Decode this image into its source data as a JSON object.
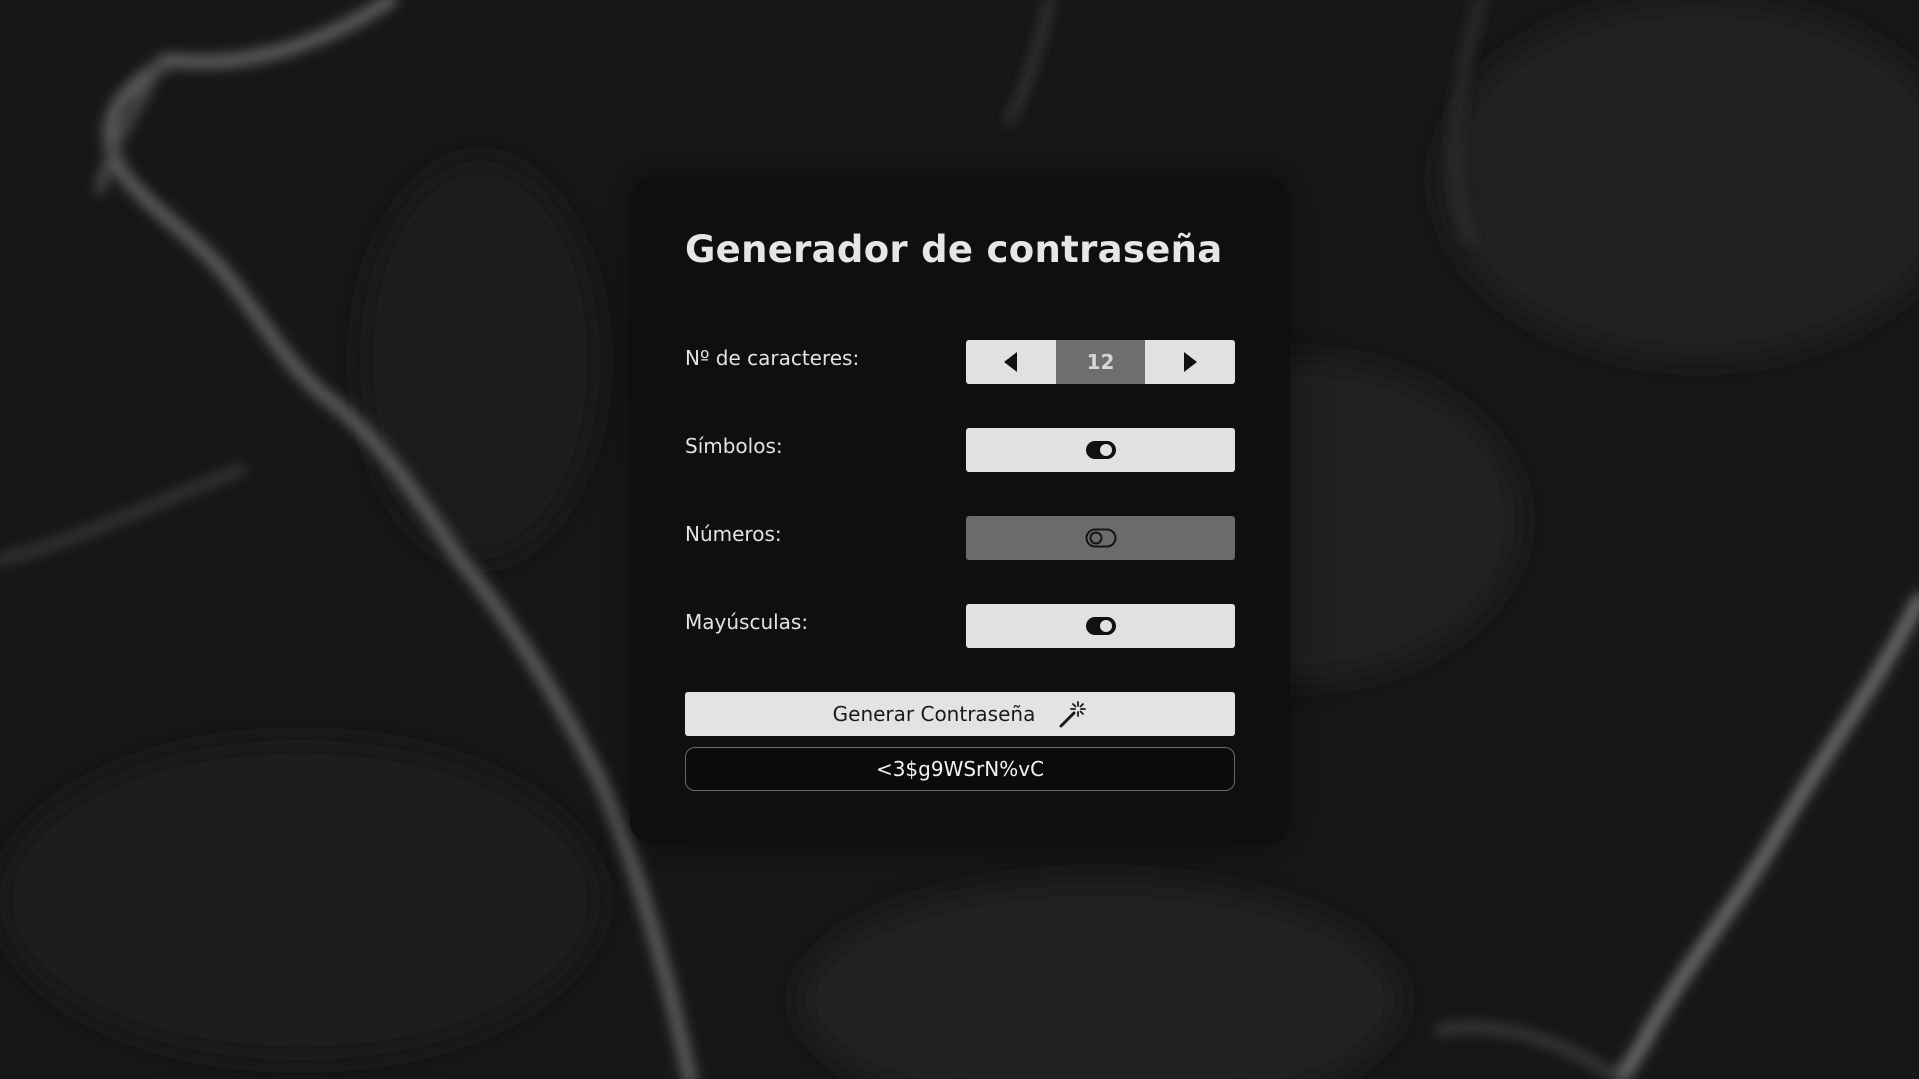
{
  "app": {
    "title": "Generador de contraseña"
  },
  "length": {
    "label": "Nº de caracteres:",
    "value": "12",
    "decrease_icon": "triangle-left-icon",
    "increase_icon": "triangle-right-icon"
  },
  "options": {
    "symbols": {
      "label": "Símbolos:",
      "enabled": true,
      "icon": "toggle-on-icon"
    },
    "numbers": {
      "label": "Números:",
      "enabled": false,
      "icon": "toggle-off-icon"
    },
    "uppercase": {
      "label": "Mayúsculas:",
      "enabled": true,
      "icon": "toggle-on-icon"
    }
  },
  "generate_button": {
    "label": "Generar Contraseña",
    "icon": "magic-wand-icon"
  },
  "output": {
    "value": "<3$g9WSrN%vC"
  },
  "colors": {
    "card_background": "#0f0f0f",
    "control_light": "#e1e1e1",
    "control_disabled": "#6b6b6b",
    "text_light": "#e6e6e6"
  }
}
